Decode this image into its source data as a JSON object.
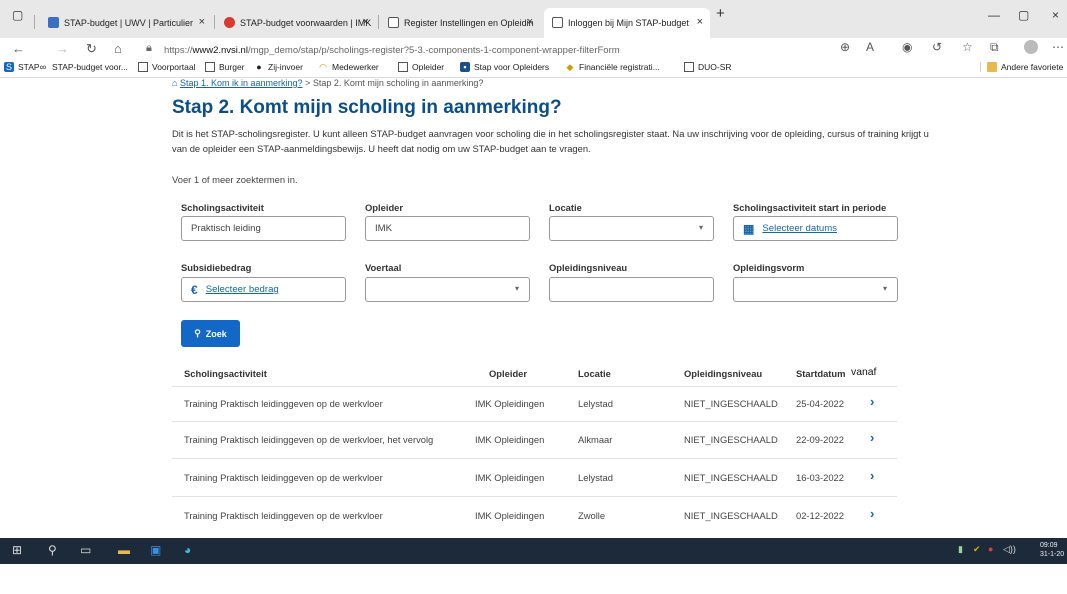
{
  "browser": {
    "tabs": [
      {
        "label": "STAP-budget | UWV | Particulier",
        "close": "×"
      },
      {
        "label": "STAP-budget voorwaarden | IMK",
        "close": "×"
      },
      {
        "label": "Register Instellingen en Opleidin",
        "close": "×"
      },
      {
        "label": "Inloggen bij Mijn STAP-budget",
        "close": "×"
      }
    ],
    "new_tab": "+",
    "window_controls": [
      "—",
      "▢",
      "×"
    ],
    "url_prefix": "https://",
    "url_host": "www2.nvsi.nl",
    "url_path": "/mgp_demo/stap/p/scholings-register?5-3.-components-1-component-wrapper-filterForm",
    "bookmarks": [
      {
        "label": "STAP",
        "icon": "stap-icon"
      },
      {
        "label": "STAP-budget voor...",
        "icon": "link-icon"
      },
      {
        "label": "Voorportaal",
        "icon": "page-icon"
      },
      {
        "label": "Burger",
        "icon": "page-icon"
      },
      {
        "label": "Zij-invoer",
        "icon": "person-icon"
      },
      {
        "label": "Medewerker",
        "icon": "headset-icon"
      },
      {
        "label": "Opleider",
        "icon": "page-icon"
      },
      {
        "label": "Stap voor Opleiders",
        "icon": "site-icon"
      },
      {
        "label": "Financiële registrati...",
        "icon": "finance-icon"
      },
      {
        "label": "DUO-SR",
        "icon": "page-icon"
      }
    ],
    "other_favorites": "Andere favoriete"
  },
  "breadcrumb": {
    "link": "Stap 1. Kom ik in aanmerking?",
    "separator": ">",
    "current": "Stap 2. Komt mijn scholing in aanmerking?"
  },
  "page": {
    "title": "Stap 2. Komt mijn scholing in aanmerking?",
    "intro": "Dit is het STAP-scholingsregister. U kunt alleen STAP-budget aanvragen voor scholing die in het scholingsregister staat. Na uw inschrijving voor de opleiding, cursus of training krijgt u van de opleider een STAP-aanmeldingsbewijs. U heeft dat nodig om uw STAP-budget aan te vragen.",
    "hint": "Voer 1 of meer zoektermen in."
  },
  "filters": {
    "scholingsactiviteit": {
      "label": "Scholingsactiviteit",
      "value": "Praktisch leiding"
    },
    "opleider": {
      "label": "Opleider",
      "value": "IMK"
    },
    "locatie": {
      "label": "Locatie",
      "value": ""
    },
    "periode": {
      "label": "Scholingsactiviteit start in periode",
      "link": "Selecteer datums"
    },
    "subsidiebedrag": {
      "label": "Subsidiebedrag",
      "link": "Selecteer bedrag",
      "symbol": "€"
    },
    "voertaal": {
      "label": "Voertaal",
      "value": ""
    },
    "opleidingsniveau": {
      "label": "Opleidingsniveau",
      "value": ""
    },
    "opleidingsvorm": {
      "label": "Opleidingsvorm",
      "value": ""
    }
  },
  "search_button": "Zoek",
  "results": {
    "headers": {
      "activiteit": "Scholingsactiviteit",
      "opleider": "Opleider",
      "locatie": "Locatie",
      "niveau": "Opleidingsniveau",
      "startdatum": "Startdatum",
      "vanaf": "vanaf"
    },
    "rows": [
      {
        "activiteit": "Training Praktisch leidinggeven op de werkvloer",
        "opleider": "IMK Opleidingen",
        "locatie": "Lelystad",
        "niveau": "NIET_INGESCHAALD",
        "startdatum": "25-04-2022"
      },
      {
        "activiteit": "Training Praktisch leidinggeven op de werkvloer, het vervolg",
        "opleider": "IMK Opleidingen",
        "locatie": "Alkmaar",
        "niveau": "NIET_INGESCHAALD",
        "startdatum": "22-09-2022"
      },
      {
        "activiteit": "Training Praktisch leidinggeven op de werkvloer",
        "opleider": "IMK Opleidingen",
        "locatie": "Lelystad",
        "niveau": "NIET_INGESCHAALD",
        "startdatum": "16-03-2022"
      },
      {
        "activiteit": "Training Praktisch leidinggeven op de werkvloer",
        "opleider": "IMK Opleidingen",
        "locatie": "Zwolle",
        "niveau": "NIET_INGESCHAALD",
        "startdatum": "02-12-2022"
      }
    ]
  },
  "taskbar": {
    "clock_time": "09:09",
    "clock_date": "31-1-20"
  },
  "colors": {
    "accent": "#1268c4",
    "title": "#0b4f8a",
    "link": "#1565a8",
    "taskbar": "#1d2a3a"
  }
}
